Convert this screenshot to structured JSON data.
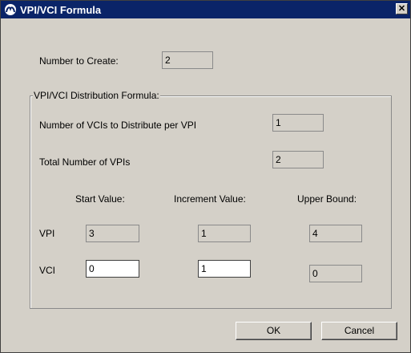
{
  "window": {
    "title": "VPI/VCI Formula",
    "close_glyph": "✕"
  },
  "number_to_create": {
    "label": "Number to Create:",
    "value": "2"
  },
  "group": {
    "title": "VPI/VCI Distribution Formula:"
  },
  "vcis_per_vpi": {
    "label": "Number of VCIs to Distribute per VPI",
    "value": "1"
  },
  "total_vpis": {
    "label": "Total Number of VPIs",
    "value": "2"
  },
  "columns": {
    "start": "Start Value:",
    "increment": "Increment Value:",
    "upper": "Upper Bound:"
  },
  "vpi": {
    "label": "VPI",
    "start": "3",
    "increment": "1",
    "upper": "4"
  },
  "vci": {
    "label": "VCI",
    "start": "0",
    "increment": "1",
    "upper": "0"
  },
  "buttons": {
    "ok": "OK",
    "cancel": "Cancel"
  },
  "icons": {
    "title": "app-logo-icon",
    "close": "close-icon"
  },
  "colors": {
    "titlebar": "#0a2468",
    "dialog": "#d4d0c8"
  }
}
